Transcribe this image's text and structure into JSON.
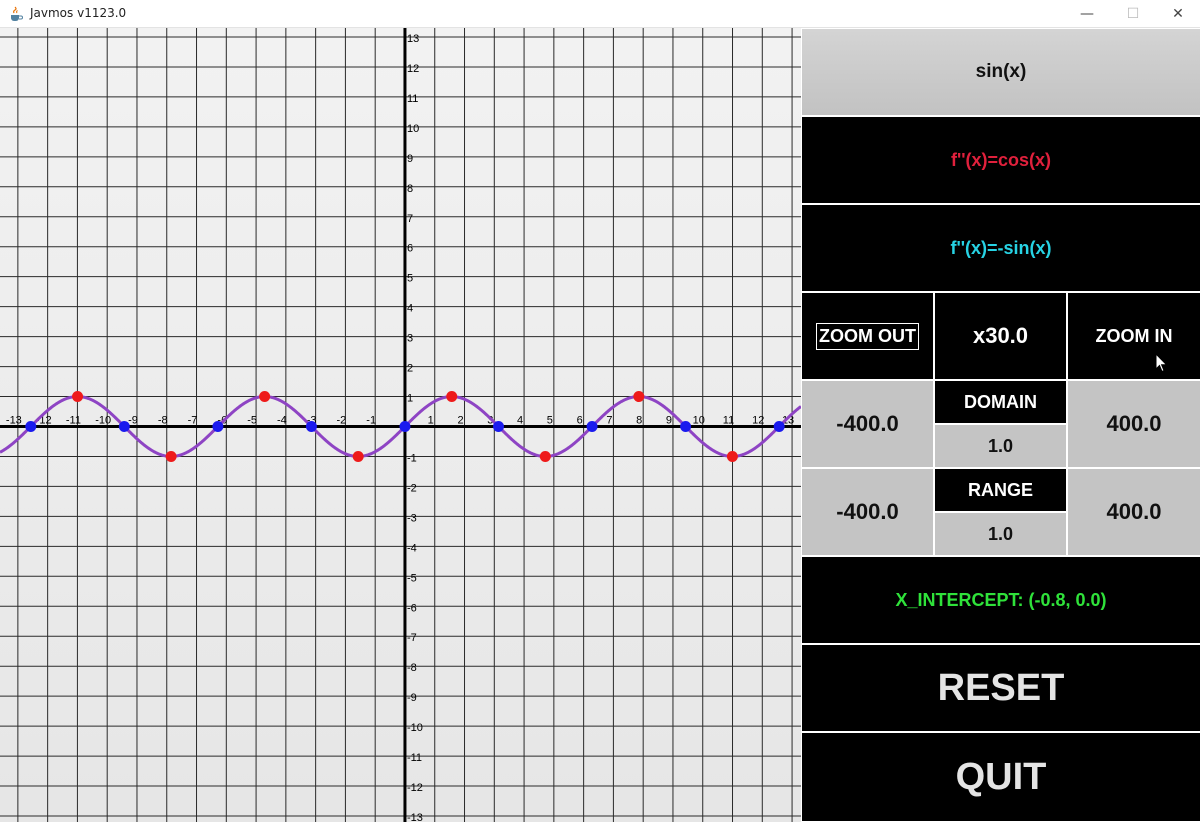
{
  "window": {
    "title": "Javmos v1123.0",
    "min_glyph": "—",
    "max_glyph": "☐",
    "close_glyph": "✕",
    "app_icon": "java-cup-icon"
  },
  "graph": {
    "x_ticks": [
      "-13",
      "-12",
      "-11",
      "-10",
      "-9",
      "-8",
      "-7",
      "-6",
      "-5",
      "-4",
      "-3",
      "-2",
      "-1",
      "1",
      "2",
      "3",
      "4",
      "5",
      "6",
      "7",
      "8",
      "9",
      "10",
      "11",
      "12",
      "13"
    ],
    "y_ticks": [
      "13",
      "12",
      "11",
      "10",
      "9",
      "8",
      "7",
      "6",
      "5",
      "4",
      "3",
      "2",
      "1",
      "-1",
      "-2",
      "-3",
      "-4",
      "-5",
      "-6",
      "-7",
      "-8",
      "-9",
      "-10",
      "-11",
      "-12",
      "-13"
    ],
    "x_range": [
      -13.6,
      13.3
    ],
    "y_range": [
      -13.2,
      13.3
    ],
    "curve_color": "#8e44c4",
    "root_point_color": "#1a1aee",
    "extremum_point_color": "#ee1a1a",
    "function": "sin"
  },
  "panel": {
    "function_display": "sin(x)",
    "first_derivative": "f''(x)=cos(x)",
    "second_derivative": "f''(x)=-sin(x)",
    "zoom_out_label": "ZOOM OUT",
    "zoom_level": "x30.0",
    "zoom_in_label": "ZOOM IN",
    "domain_min": "-400.0",
    "domain_label": "DOMAIN",
    "domain_step": "1.0",
    "domain_max": "400.0",
    "range_min": "-400.0",
    "range_label": "RANGE",
    "range_step": "1.0",
    "range_max": "400.0",
    "x_intercept": "X_INTERCEPT: (-0.8, 0.0)",
    "reset_label": "RESET",
    "quit_label": "QUIT"
  }
}
